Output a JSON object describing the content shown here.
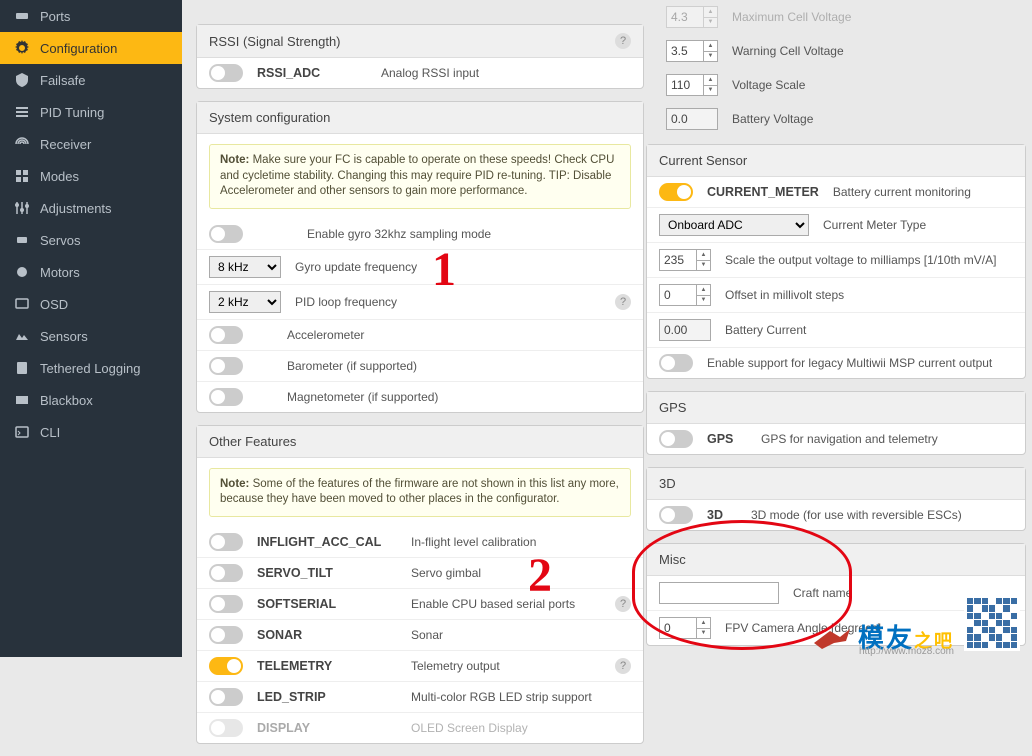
{
  "sidebar": {
    "items": [
      {
        "label": "Ports",
        "icon": "ports"
      },
      {
        "label": "Configuration",
        "icon": "gear",
        "active": true
      },
      {
        "label": "Failsafe",
        "icon": "failsafe"
      },
      {
        "label": "PID Tuning",
        "icon": "pid"
      },
      {
        "label": "Receiver",
        "icon": "receiver"
      },
      {
        "label": "Modes",
        "icon": "modes"
      },
      {
        "label": "Adjustments",
        "icon": "adjust"
      },
      {
        "label": "Servos",
        "icon": "servos"
      },
      {
        "label": "Motors",
        "icon": "motors"
      },
      {
        "label": "OSD",
        "icon": "osd"
      },
      {
        "label": "Sensors",
        "icon": "sensors"
      },
      {
        "label": "Tethered Logging",
        "icon": "log"
      },
      {
        "label": "Blackbox",
        "icon": "blackbox"
      },
      {
        "label": "CLI",
        "icon": "cli"
      }
    ]
  },
  "rssi": {
    "title": "RSSI (Signal Strength)",
    "toggle": {
      "on": false
    },
    "name": "RSSI_ADC",
    "desc": "Analog RSSI input"
  },
  "system": {
    "title": "System configuration",
    "note_prefix": "Note:",
    "note": "Make sure your FC is capable to operate on these speeds! Check CPU and cycletime stability. Changing this may require PID re-tuning. TIP: Disable Accelerometer and other sensors to gain more performance.",
    "rows": [
      {
        "type": "toggle",
        "on": false,
        "desc": "Enable gyro 32khz sampling mode"
      },
      {
        "type": "select",
        "value": "8 kHz",
        "desc": "Gyro update frequency"
      },
      {
        "type": "select",
        "value": "2 kHz",
        "desc": "PID loop frequency",
        "help": true
      },
      {
        "type": "toggle",
        "on": false,
        "desc": "Accelerometer"
      },
      {
        "type": "toggle",
        "on": false,
        "desc": "Barometer (if supported)"
      },
      {
        "type": "toggle",
        "on": false,
        "desc": "Magnetometer (if supported)"
      }
    ]
  },
  "other": {
    "title": "Other Features",
    "note_prefix": "Note:",
    "note": "Some of the features of the firmware are not shown in this list any more, because they have been moved to other places in the configurator.",
    "rows": [
      {
        "on": false,
        "name": "INFLIGHT_ACC_CAL",
        "desc": "In-flight level calibration"
      },
      {
        "on": false,
        "name": "SERVO_TILT",
        "desc": "Servo gimbal"
      },
      {
        "on": false,
        "name": "SOFTSERIAL",
        "desc": "Enable CPU based serial ports",
        "help": true
      },
      {
        "on": false,
        "name": "SONAR",
        "desc": "Sonar"
      },
      {
        "on": true,
        "name": "TELEMETRY",
        "desc": "Telemetry output",
        "help": true
      },
      {
        "on": false,
        "name": "LED_STRIP",
        "desc": "Multi-color RGB LED strip support"
      },
      {
        "on": false,
        "name": "DISPLAY",
        "desc": "OLED Screen Display"
      }
    ]
  },
  "voltage_top": [
    {
      "value": "4.3",
      "desc": "Maximum Cell Voltage"
    },
    {
      "value": "3.5",
      "desc": "Warning Cell Voltage"
    },
    {
      "value": "110",
      "desc": "Voltage Scale"
    },
    {
      "value": "0.0",
      "desc": "Battery Voltage"
    }
  ],
  "current": {
    "title": "Current Sensor",
    "toggle": {
      "on": true,
      "name": "CURRENT_METER",
      "desc": "Battery current monitoring"
    },
    "meter_type": {
      "value": "Onboard ADC",
      "desc": "Current Meter Type"
    },
    "rows": [
      {
        "value": "235",
        "desc": "Scale the output voltage to milliamps [1/10th mV/A]"
      },
      {
        "value": "0",
        "desc": "Offset in millivolt steps"
      },
      {
        "value": "0.00",
        "desc": "Battery Current"
      }
    ],
    "legacy": {
      "on": false,
      "desc": "Enable support for legacy Multiwii MSP current output"
    }
  },
  "gps": {
    "title": "GPS",
    "toggle": {
      "on": false,
      "name": "GPS",
      "desc": "GPS for navigation and telemetry"
    }
  },
  "three_d": {
    "title": "3D",
    "toggle": {
      "on": false,
      "name": "3D",
      "desc": "3D mode (for use with reversible ESCs)"
    }
  },
  "misc": {
    "title": "Misc",
    "craft_name": {
      "value": "",
      "desc": "Craft name"
    },
    "fpv": {
      "value": "0",
      "desc": "FPV Camera Angle [degrees]"
    }
  },
  "annotations": {
    "one": "1",
    "two": "2"
  },
  "watermark": {
    "brand_b": "模友",
    "brand_y": "之吧",
    "url": "http://www.moz8.com"
  }
}
